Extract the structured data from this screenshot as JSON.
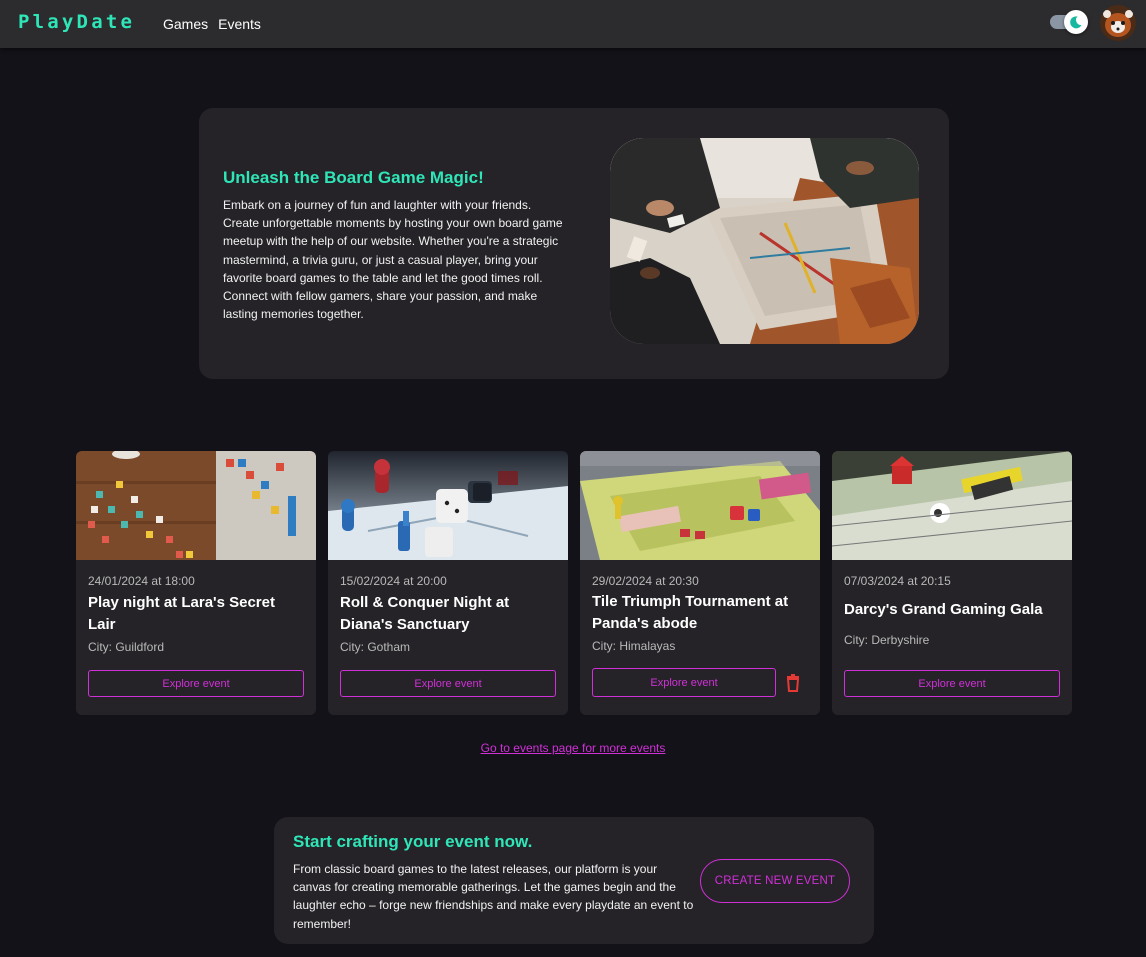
{
  "header": {
    "logo": "PlayDate",
    "nav": [
      "Games",
      "Events"
    ]
  },
  "hero": {
    "title": "Unleash the Board Game Magic!",
    "text": "Embark on a journey of fun and laughter with your friends. Create unforgettable moments by hosting your own board game meetup with the help of our website. Whether you're a strategic mastermind, a trivia guru, or just a casual player, bring your favorite board games to the table and let the good times roll. Connect with fellow gamers, share your passion, and make lasting memories together."
  },
  "events": [
    {
      "date": "24/01/2024 at 18:00",
      "title": "Play night at Lara's Secret Lair",
      "city": "City: Guildford",
      "button": "Explore event"
    },
    {
      "date": "15/02/2024 at 20:00",
      "title": "Roll & Conquer Night at Diana's Sanctuary",
      "city": "City: Gotham",
      "button": "Explore event"
    },
    {
      "date": "29/02/2024 at 20:30",
      "title": "Tile Triumph Tournament at Panda's abode",
      "city": "City: Himalayas",
      "button": "Explore event"
    },
    {
      "date": "07/03/2024 at 20:15",
      "title": "Darcy's Grand Gaming Gala",
      "city": "City: Derbyshire",
      "button": "Explore event"
    }
  ],
  "more_link": "Go to events page for more events",
  "cta": {
    "title": "Start crafting your event now.",
    "text": "From classic board games to the latest releases, our platform is your canvas for creating memorable gatherings. Let the games begin and the laughter echo – forge new friendships and make every playdate an event to remember!",
    "button": "CREATE NEW EVENT"
  },
  "colors": {
    "accent_teal": "#2ee6b8",
    "accent_magenta": "#d030d8",
    "delete_red": "#e53935",
    "background": "#131218",
    "card": "#252327"
  }
}
